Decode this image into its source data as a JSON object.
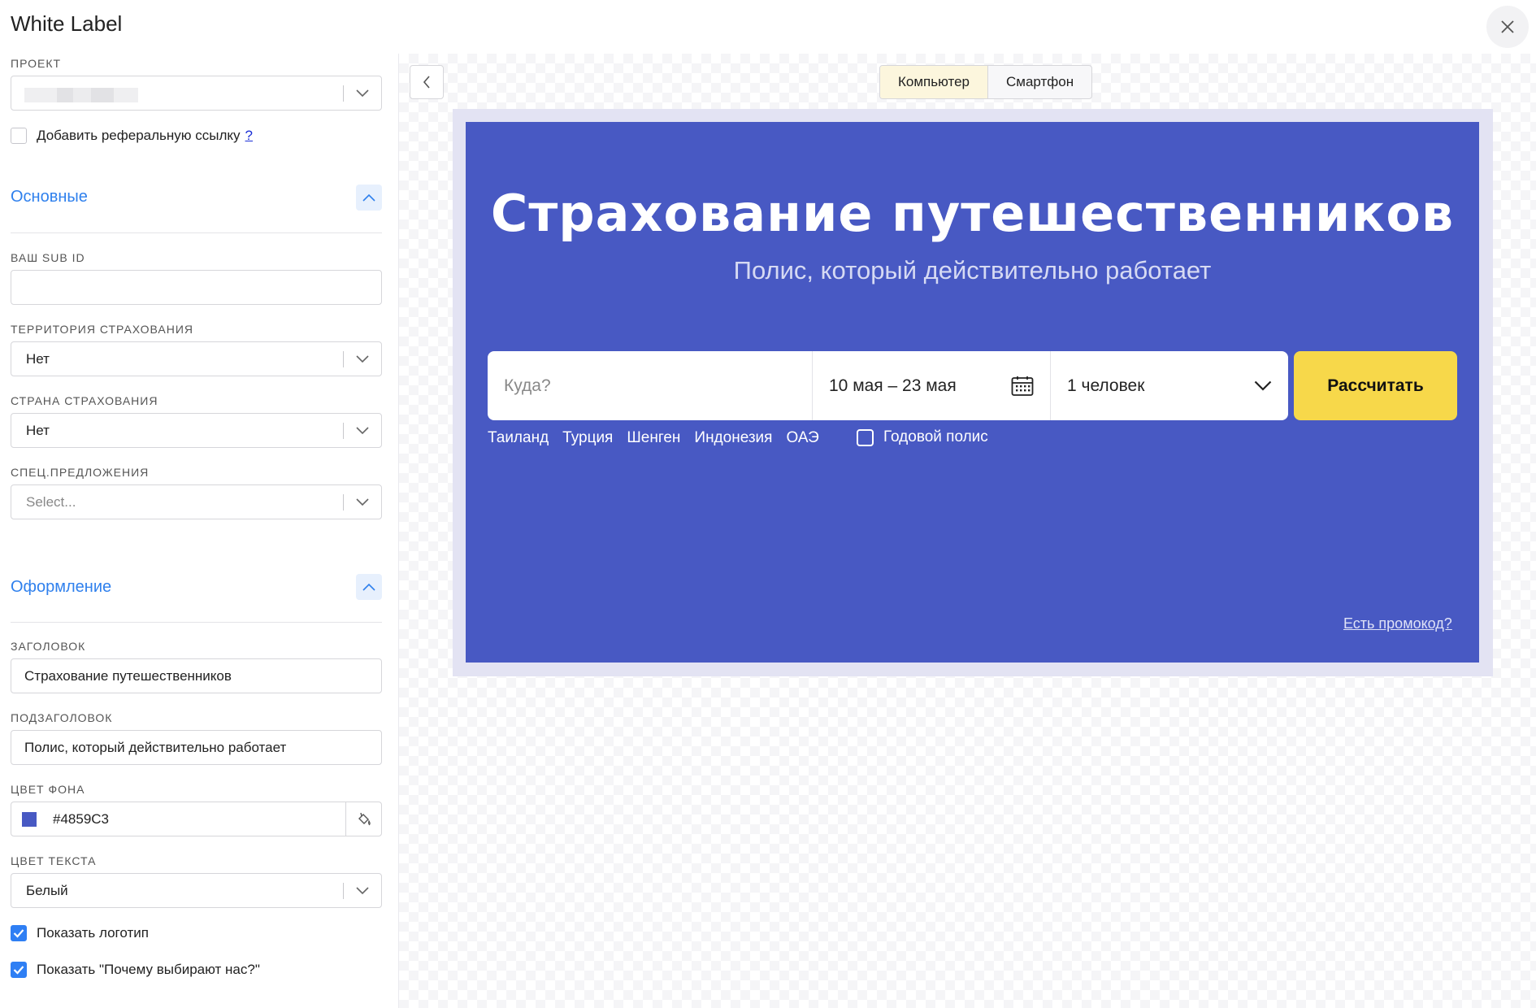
{
  "window": {
    "title": "White Label"
  },
  "sidebar": {
    "project_label": "ПРОЕКТ",
    "referral_label": "Добавить реферальную ссылку",
    "referral_help": "?",
    "section_main": "Основные",
    "subid_label": "ВАШ SUB ID",
    "subid_value": "",
    "territory_label": "ТЕРРИТОРИЯ СТРАХОВАНИЯ",
    "territory_value": "Нет",
    "country_label": "СТРАНА СТРАХОВАНИЯ",
    "country_value": "Нет",
    "special_label": "СПЕЦ.ПРЕДЛОЖЕНИЯ",
    "special_placeholder": "Select...",
    "section_design": "Оформление",
    "heading_label": "ЗАГОЛОВОК",
    "heading_value": "Страхование путешественников",
    "subheading_label": "ПОДЗАГОЛОВОК",
    "subheading_value": "Полис, который действительно работает",
    "bgcolor_label": "ЦВЕТ ФОНА",
    "bgcolor_value": "#4859C3",
    "textcolor_label": "ЦВЕТ ТЕКСТА",
    "textcolor_value": "Белый",
    "show_logo_label": "Показать логотип",
    "show_logo_checked": true,
    "show_why_label": "Показать \"Почему выбирают нас?\"",
    "show_why_checked": true
  },
  "preview": {
    "tabs": [
      {
        "label": "Компьютер",
        "active": true
      },
      {
        "label": "Смартфон",
        "active": false
      }
    ],
    "hero": {
      "title": "Страхование путешественников",
      "subtitle": "Полис, который действительно работает",
      "destination_placeholder": "Куда?",
      "dates": "10 мая – 23 мая",
      "travellers": "1 человек",
      "button": "Рассчитать",
      "quick_links": [
        "Таиланд",
        "Турция",
        "Шенген",
        "Индонезия",
        "ОАЭ"
      ],
      "annual_label": "Годовой полис",
      "promo": "Есть промокод?"
    }
  },
  "colors": {
    "accent": "#2f80ed",
    "hero_bg": "#4859C3",
    "button": "#f7d84a"
  },
  "icons": [
    "close-icon",
    "chevron-down-icon",
    "chevron-up-icon",
    "chevron-left-icon",
    "paint-bucket-icon",
    "calendar-icon",
    "check-icon"
  ]
}
